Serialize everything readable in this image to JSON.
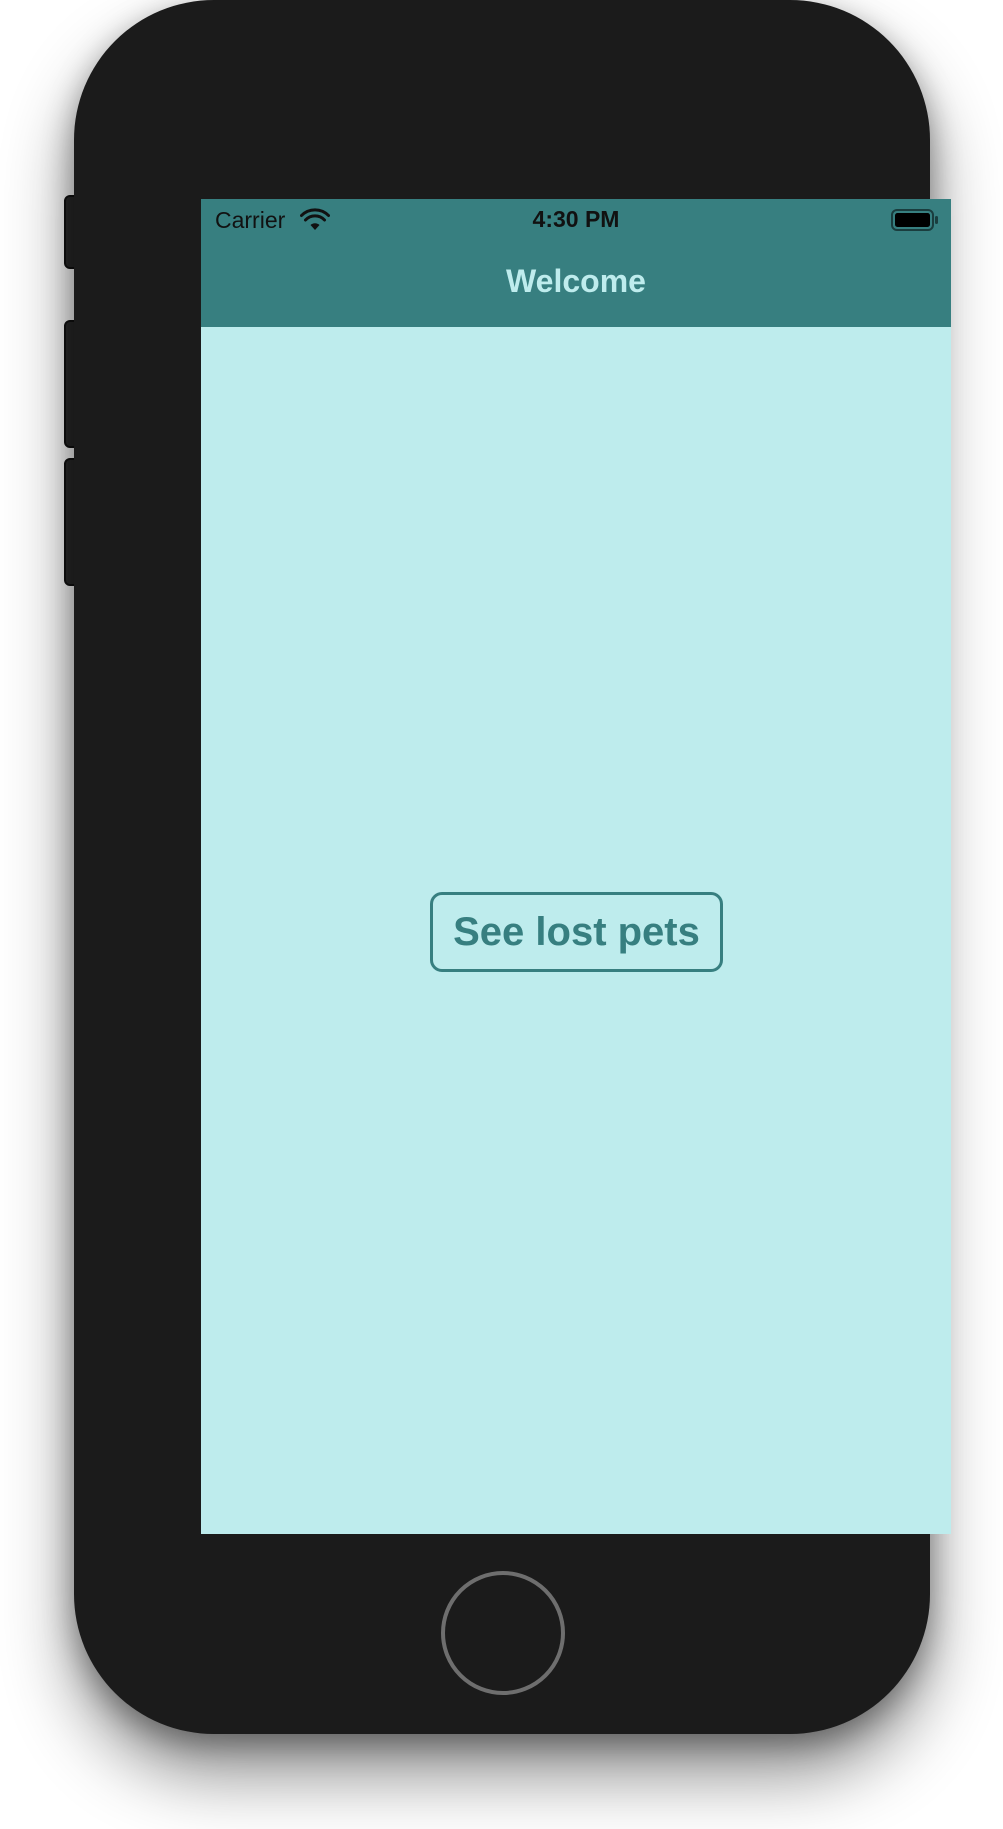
{
  "status_bar": {
    "carrier": "Carrier",
    "time": "4:30 PM",
    "wifi_icon": "wifi-icon",
    "battery_icon": "battery-full-icon"
  },
  "nav_bar": {
    "title": "Welcome"
  },
  "main": {
    "primary_button_label": "See lost pets"
  },
  "colors": {
    "nav_background": "#377f80",
    "screen_background": "#beeced",
    "nav_title": "#beeced",
    "button_accent": "#377f80",
    "device_body": "#1b1b1b"
  }
}
